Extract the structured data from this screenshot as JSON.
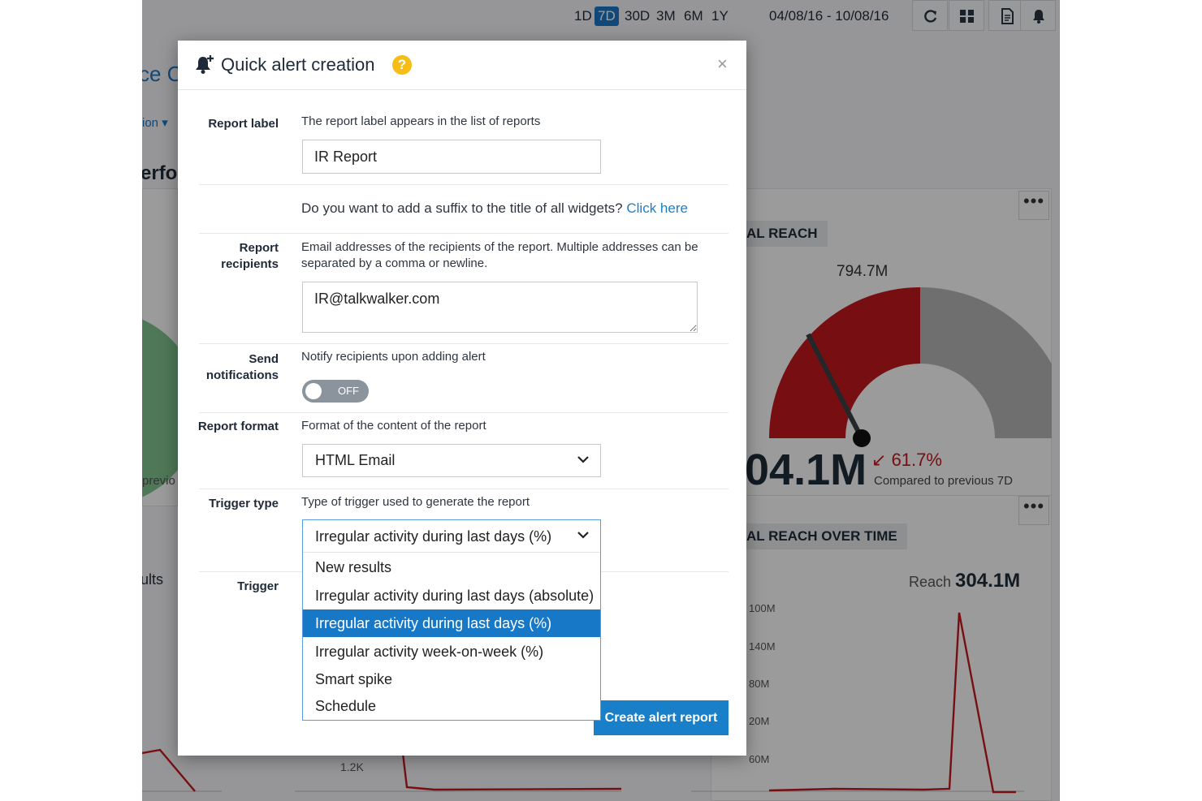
{
  "background": {
    "range_buttons": [
      "1D",
      "7D",
      "30D",
      "3M",
      "6M",
      "1Y"
    ],
    "active_range": "7D",
    "date_range": "04/08/16 - 10/08/16",
    "partial_title": "ce Cr",
    "partial_dropdown": "ion",
    "partial_section": "erfo",
    "partial_previous": "previo",
    "partial_results": "ults",
    "card_reach_label": "AL REACH",
    "gauge_max_label": "794.7M",
    "big_value": "04.1M",
    "change_pct": "61.7%",
    "change_caption": "Compared to previous 7D",
    "card_time_label": "AL REACH OVER TIME",
    "reach_caption": "Reach",
    "reach_value": "304.1M",
    "left_tick": "1.2K",
    "y_ticks": [
      "100M",
      "140M",
      "80M",
      "20M",
      "60M"
    ],
    "dots": "•••",
    "colors": {
      "accent": "#1a74c4",
      "negative": "#c0191d",
      "gauge_gray": "#b4b4b4"
    }
  },
  "modal": {
    "title": "Quick alert creation",
    "help": "?",
    "close": "×",
    "report_label": {
      "label": "Report label",
      "description": "The report label appears in the list of reports",
      "value": "IR Report"
    },
    "suffix": {
      "question": "Do you want to add a suffix to the title of all widgets?",
      "link": "Click here"
    },
    "recipients": {
      "label_line1": "Report",
      "label_line2": "recipients",
      "description_line1": "Email addresses of the recipients of the report. Multiple addresses can be",
      "description_line2": "separated by a comma or newline.",
      "value": "IR@talkwalker.com"
    },
    "notifications": {
      "label_line1": "Send",
      "label_line2": "notifications",
      "description": "Notify recipients upon adding alert",
      "toggle_state": "OFF"
    },
    "report_format": {
      "label": "Report format",
      "description": "Format of the content of the report",
      "value": "HTML Email"
    },
    "trigger_type": {
      "label": "Trigger type",
      "description": "Type of trigger used to generate the report",
      "value": "Irregular activity during last days (%)",
      "options": [
        "New results",
        "Irregular activity during last days (absolute)",
        "Irregular activity during last days (%)",
        "Irregular activity week-on-week (%)",
        "Smart spike",
        "Schedule"
      ],
      "selected_index": 2
    },
    "trigger": {
      "label": "Trigger"
    },
    "create_button": "Create alert report"
  }
}
